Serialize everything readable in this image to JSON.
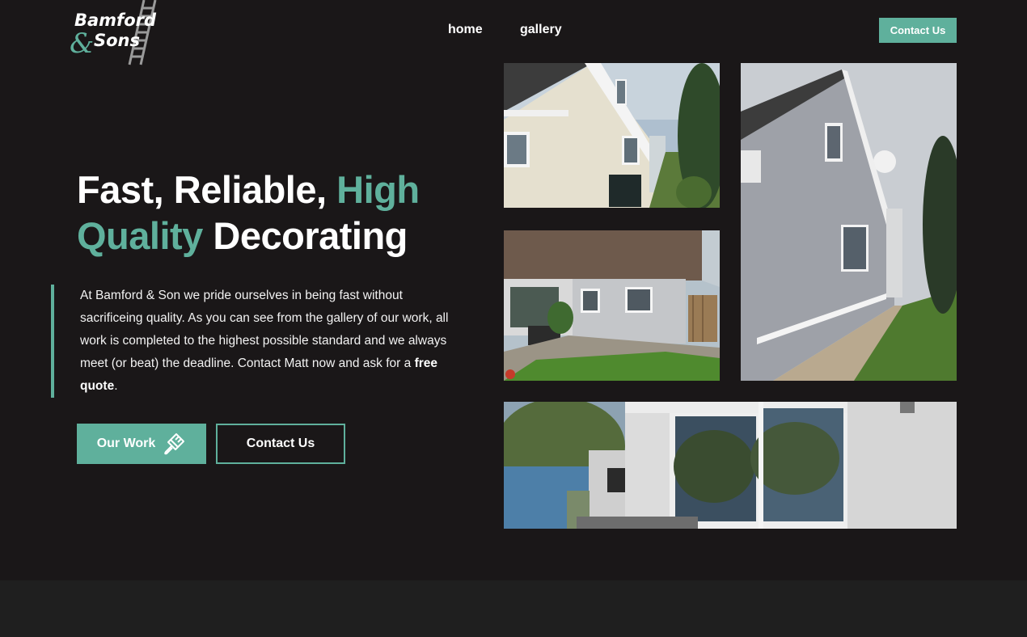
{
  "logo": {
    "line1": "Bamford",
    "ampersand": "&",
    "line2": "Sons"
  },
  "nav": {
    "home": "home",
    "gallery": "gallery",
    "contact_button": "Contact Us"
  },
  "hero": {
    "headline_part1": "Fast, Reliable, ",
    "headline_accent1": "High",
    "headline_accent2": "Quality",
    "headline_part2": " Decorating",
    "intro_text": "At Bamford & Son we pride ourselves in being fast without sacrificeing quality. As you can see from the gallery of our work, all work is completed to the highest possible standard and we always meet (or beat) the deadline. Contact Matt now and ask for a ",
    "intro_bold": "free quote",
    "intro_end": ".",
    "our_work_button": "Our Work",
    "contact_button": "Contact Us"
  },
  "icons": {
    "logo": "ladder-icon",
    "our_work": "paintbrush-icon"
  },
  "colors": {
    "background": "#1a1718",
    "accent": "#5fb09c",
    "footer": "#1f1f1f",
    "text": "#ffffff"
  }
}
